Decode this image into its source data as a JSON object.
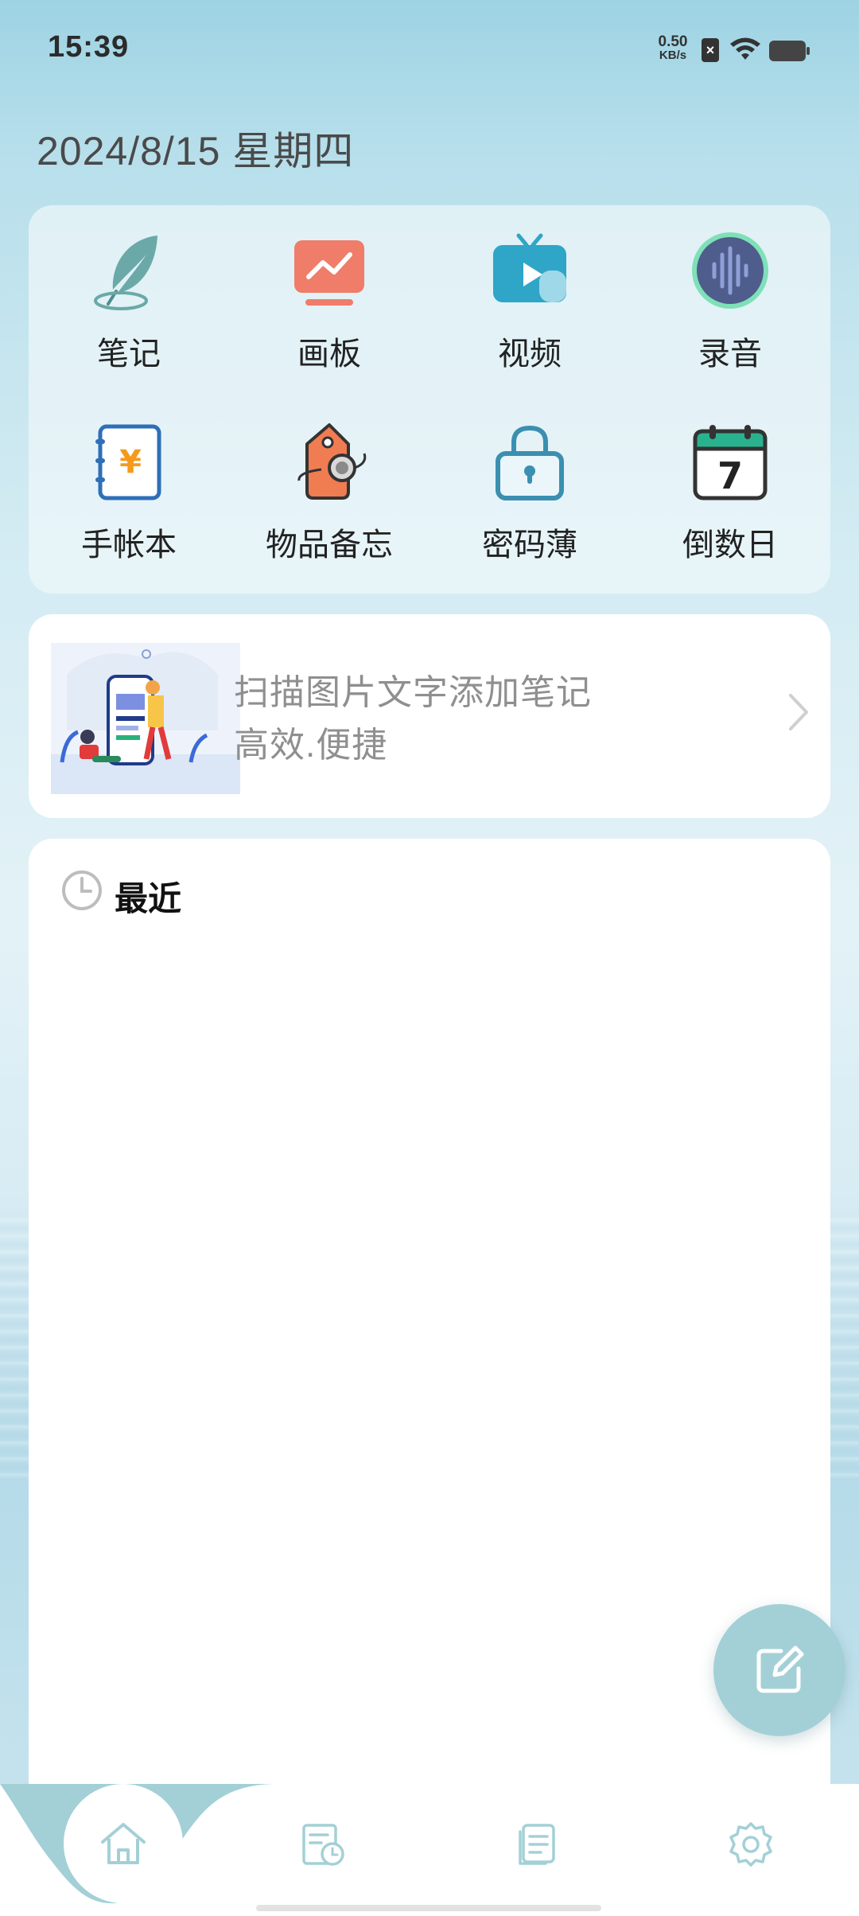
{
  "status_bar": {
    "time": "15:39",
    "net_speed_value": "0.50",
    "net_speed_unit": "KB/s",
    "sim_icon": "no-sim-icon",
    "wifi_icon": "wifi-icon",
    "battery_icon": "battery-icon"
  },
  "header": {
    "date": "2024/8/15 星期四"
  },
  "apps": [
    {
      "label": "笔记",
      "icon": "feather-icon"
    },
    {
      "label": "画板",
      "icon": "drawing-board-icon"
    },
    {
      "label": "视频",
      "icon": "tv-video-icon"
    },
    {
      "label": "录音",
      "icon": "voice-wave-icon"
    },
    {
      "label": "手帐本",
      "icon": "yen-notebook-icon"
    },
    {
      "label": "物品备忘",
      "icon": "tag-icon"
    },
    {
      "label": "密码薄",
      "icon": "lock-icon"
    },
    {
      "label": "倒数日",
      "icon": "calendar-icon"
    }
  ],
  "calendar_day": "7",
  "scan_banner": {
    "line1": "扫描图片文字添加笔记",
    "line2": "高效.便捷"
  },
  "recent": {
    "title": "最近"
  },
  "bottom_nav": [
    {
      "icon": "home-icon",
      "active": true
    },
    {
      "icon": "reminder-icon",
      "active": false
    },
    {
      "icon": "document-icon",
      "active": false
    },
    {
      "icon": "settings-icon",
      "active": false
    }
  ],
  "colors": {
    "accent": "#a3d0d6",
    "note_teal": "#6aa9a8",
    "board_red": "#f07c6a",
    "video_blue": "#2fa6c8",
    "record_purple": "#4e5d8c",
    "notebook_blue": "#2e6fb8",
    "tag_orange": "#f07c52",
    "lock_blue": "#3b8fb0",
    "calendar_green": "#2ab28f"
  }
}
